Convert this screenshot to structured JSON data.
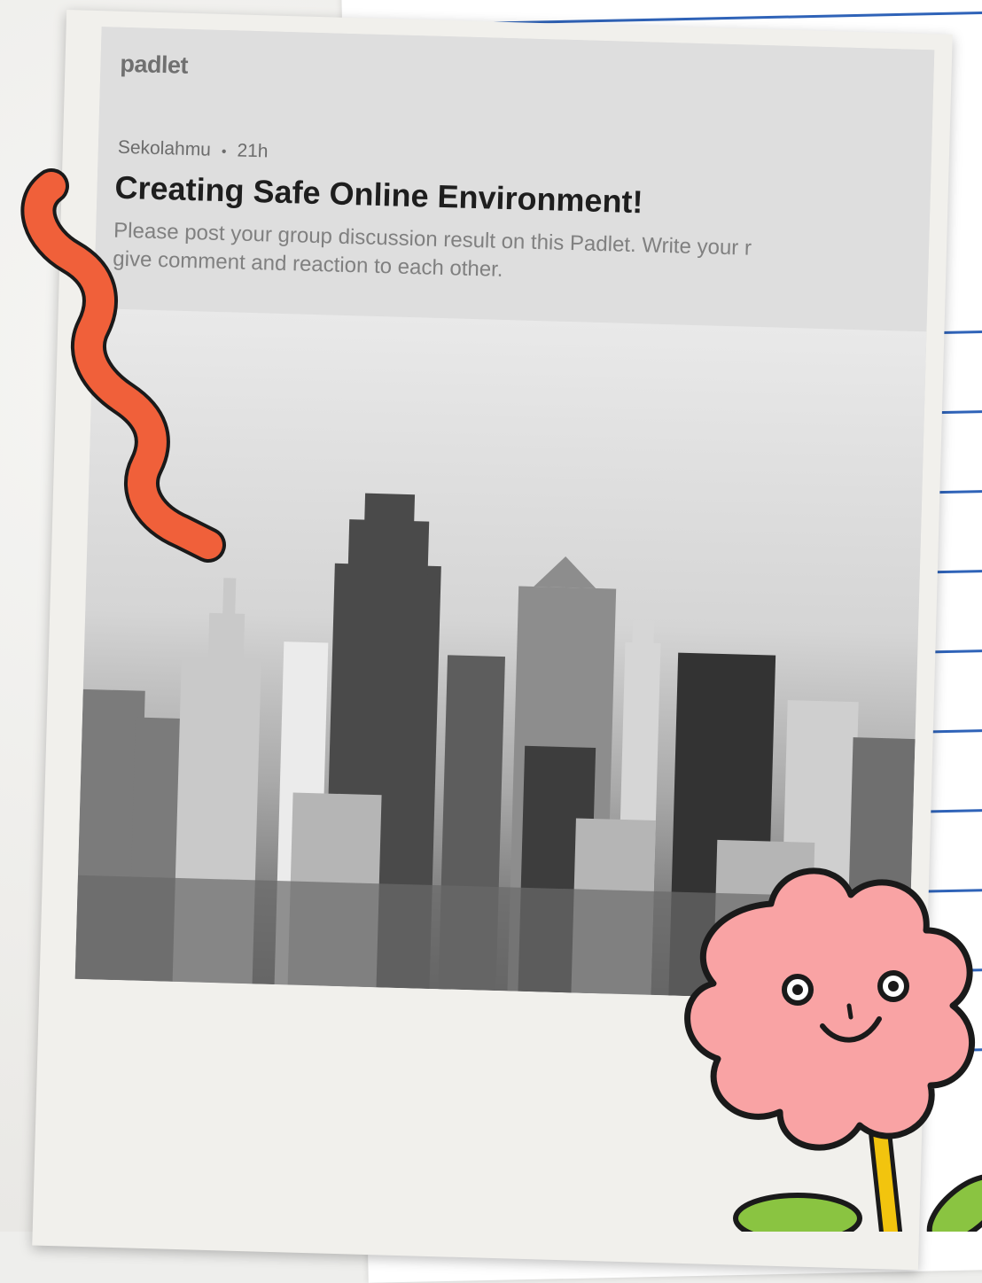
{
  "post": {
    "app_logo": "padlet",
    "author": "Sekolahmu",
    "separator": "•",
    "time_ago": "21h",
    "title": "Creating Safe Online Environment!",
    "description_line1": "Please post your group discussion result on this Padlet. Write your r",
    "description_line2": "give comment and reaction to each other."
  },
  "colors": {
    "squiggle": "#f0603a",
    "flower_petals": "#f9a3a4",
    "stem": "#f2c40e",
    "leaves": "#8ac441",
    "notebook_lines": "#2f63b8"
  },
  "icons": [
    "squiggle-decoration",
    "smiling-flower-sticker",
    "city-skyline-photo"
  ]
}
